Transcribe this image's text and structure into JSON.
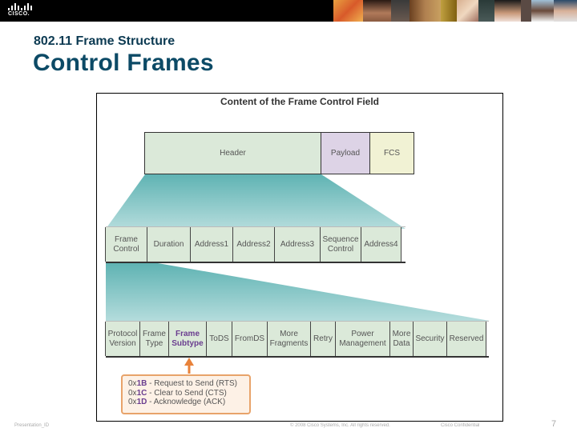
{
  "brand": {
    "logo_text": "CISCO.",
    "logo_icon": "cisco-bridge-icon"
  },
  "slide": {
    "subtitle": "802.11 Frame Structure",
    "title": "Control Frames"
  },
  "figure": {
    "title": "Content of the Frame Control Field",
    "frame": [
      {
        "label": "Header",
        "color": "#dbe9d9"
      },
      {
        "label": "Payload",
        "color": "#ddd3e6"
      },
      {
        "label": "FCS",
        "color": "#f1f2d4"
      }
    ],
    "header_fields": [
      {
        "label": "Frame Control"
      },
      {
        "label": "Duration"
      },
      {
        "label": "Address1"
      },
      {
        "label": "Address2"
      },
      {
        "label": "Address3"
      },
      {
        "label": "Sequence Control"
      },
      {
        "label": "Address4"
      }
    ],
    "frame_control_fields": [
      {
        "label": "Protocol Version"
      },
      {
        "label": "Frame Type"
      },
      {
        "label": "Frame Subtype",
        "highlight": true
      },
      {
        "label": "ToDS"
      },
      {
        "label": "FromDS"
      },
      {
        "label": "More Fragments"
      },
      {
        "label": "Retry"
      },
      {
        "label": "Power Management"
      },
      {
        "label": "More Data"
      },
      {
        "label": "Security"
      },
      {
        "label": "Reserved"
      }
    ],
    "callout": {
      "arrow_color": "#e8823a",
      "lines": [
        {
          "prefix": "0x",
          "code": "1B",
          "text": " - Request to Send (RTS)"
        },
        {
          "prefix": "0x",
          "code": "1C",
          "text": " - Clear to Send (CTS)"
        },
        {
          "prefix": "0x",
          "code": "1D",
          "text": " - Acknowledge (ACK)"
        }
      ]
    }
  },
  "footer": {
    "left": "Presentation_ID",
    "center": "© 2008 Cisco Systems, Inc. All rights reserved.",
    "right": "Cisco Confidential",
    "page": "7"
  }
}
